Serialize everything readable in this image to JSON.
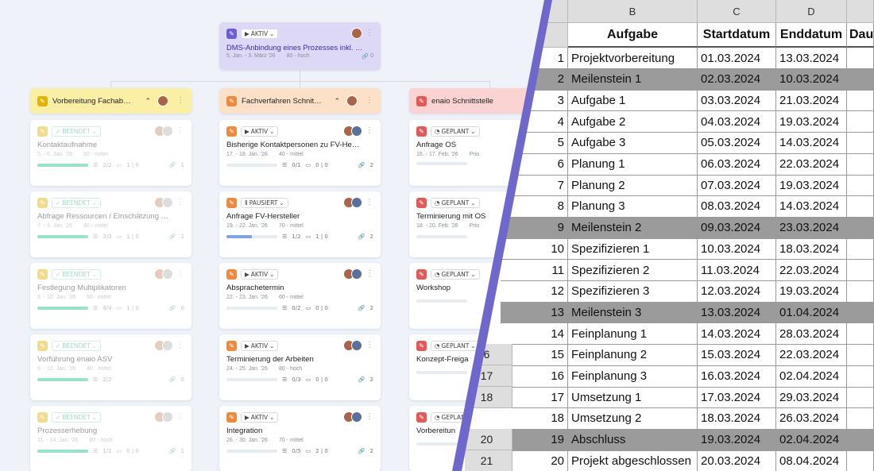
{
  "kanban": {
    "top_card": {
      "status": "AKTIV",
      "title": "DMS-Anbindung eines Prozesses inkl. …",
      "dates": "5. Jan. - 3. März '26",
      "effort": "80 - hoch",
      "links": "0"
    },
    "columns": [
      {
        "title": "Vorbereitung Fachab…",
        "collapse_icon": "chevron-up-icon",
        "cards": [
          {
            "status": "BEENDET",
            "title": "Kontaktaufnahme",
            "dates": "5. - 6. Jan. '26",
            "effort": "50 - mittel",
            "checklist": "2/2",
            "counts": "1 | 0",
            "links": "1",
            "progress": 100
          },
          {
            "status": "BEENDET",
            "title": "Abfrage Ressourcen / Einschätzung …",
            "dates": "7. - 9. Jan. '26",
            "effort": "60 - mittel",
            "checklist": "3/3",
            "counts": "1 | 0",
            "links": "1",
            "progress": 100
          },
          {
            "status": "BEENDET",
            "title": "Festlegung Multiplikatoren",
            "dates": "9. - 10. Jan. '26",
            "effort": "50 - mittel",
            "checklist": "4/4",
            "counts": "1 | 0",
            "links": "0",
            "progress": 100
          },
          {
            "status": "BEENDET",
            "title": "Vorführung enaio ASV",
            "dates": "9. - 12. Jan. '26",
            "effort": "40 - mittel",
            "checklist": "2/2",
            "counts": "",
            "links": "0",
            "progress": 100
          },
          {
            "status": "BEENDET",
            "title": "Prozesserhebung",
            "dates": "11. - 14. Jan. '26",
            "effort": "80 - hoch",
            "checklist": "1/1",
            "counts": "0 | 0",
            "links": "1",
            "progress": 100
          }
        ]
      },
      {
        "title": "Fachverfahren Schnit…",
        "collapse_icon": "chevron-up-icon",
        "cards": [
          {
            "status": "AKTIV",
            "title": "Bisherige Kontaktpersonen zu FV-He…",
            "dates": "17. - 18. Jan. '26",
            "effort": "40 - mittel",
            "checklist": "0/1",
            "counts": "0 | 0",
            "links": "2",
            "progress": 0
          },
          {
            "status": "PAUSIERT",
            "title": "Anfrage FV-Hersteller",
            "dates": "19. - 22. Jan. '26",
            "effort": "70 - mittel",
            "checklist": "1/2",
            "counts": "1 | 0",
            "links": "2",
            "progress": 50
          },
          {
            "status": "AKTIV",
            "title": "Absprachetermin",
            "dates": "22. - 23. Jan. '26",
            "effort": "60 - mittel",
            "checklist": "0/2",
            "counts": "0 | 0",
            "links": "2",
            "progress": 0
          },
          {
            "status": "AKTIV",
            "title": "Terminierung der Arbeiten",
            "dates": "24. - 25. Jan. '26",
            "effort": "80 - hoch",
            "checklist": "0/3",
            "counts": "0 | 0",
            "links": "2",
            "progress": 0
          },
          {
            "status": "AKTIV",
            "title": "Integration",
            "dates": "26. - 30. Jan. '26",
            "effort": "70 - mittel",
            "checklist": "0/5",
            "counts": "2 | 0",
            "links": "2",
            "progress": 0
          }
        ]
      },
      {
        "title": "enaio Schnittstelle",
        "cards": [
          {
            "status": "GEPLANT",
            "title": "Anfrage OS",
            "dates": "16. - 17. Feb. '26",
            "effort": "Prio",
            "checklist": "",
            "counts": "",
            "links": "",
            "progress": 0
          },
          {
            "status": "GEPLANT",
            "title": "Terminierung mit OS",
            "dates": "18. - 20. Feb. '26",
            "effort": "Prio",
            "checklist": "",
            "counts": "",
            "links": "0",
            "progress": 0
          },
          {
            "status": "GEPLANT",
            "title": "Workshop",
            "dates": "",
            "effort": "",
            "checklist": "",
            "counts": "",
            "links": "",
            "progress": 0
          },
          {
            "status": "GEPLANT",
            "title": "Konzept-Freiga",
            "dates": "",
            "effort": "",
            "checklist": "",
            "counts": "",
            "links": "",
            "progress": 0
          },
          {
            "status": "GEPLANT",
            "title": "Vorbereitun",
            "dates": "",
            "effort": "",
            "checklist": "",
            "counts": "",
            "links": "",
            "progress": 0
          }
        ]
      }
    ],
    "colors": {
      "top": "#dcd8f6",
      "col1": "#fbefa6",
      "col2": "#fde0c8",
      "col3": "#fbd3d3",
      "done": "#1fbf8a",
      "blue": "#7fa5e0",
      "pen_top": "#6b5dd3",
      "pen1": "#e0b400",
      "pen2": "#ef8a3c",
      "pen3": "#e05a5a"
    }
  },
  "sheet": {
    "col_letters": [
      "B",
      "C",
      "D"
    ],
    "headers": [
      "Aufgabe",
      "Startdatum",
      "Enddatum",
      "Dau"
    ],
    "left_row_numbers": [
      "6",
      "17",
      "18",
      "20",
      "21"
    ],
    "rows": [
      {
        "n": "1",
        "task": "Projektvorbereitung",
        "start": "01.03.2024",
        "end": "13.03.2024",
        "milestone": false
      },
      {
        "n": "2",
        "task": "Meilenstein 1",
        "start": "02.03.2024",
        "end": "10.03.2024",
        "milestone": true
      },
      {
        "n": "3",
        "task": "Aufgabe 1",
        "start": "03.03.2024",
        "end": "21.03.2024",
        "milestone": false
      },
      {
        "n": "4",
        "task": "Aufgabe 2",
        "start": "04.03.2024",
        "end": "19.03.2024",
        "milestone": false
      },
      {
        "n": "5",
        "task": "Aufgabe 3",
        "start": "05.03.2024",
        "end": "14.03.2024",
        "milestone": false
      },
      {
        "n": "6",
        "task": "Planung 1",
        "start": "06.03.2024",
        "end": "22.03.2024",
        "milestone": false
      },
      {
        "n": "7",
        "task": "Planung 2",
        "start": "07.03.2024",
        "end": "19.03.2024",
        "milestone": false
      },
      {
        "n": "8",
        "task": "Planung 3",
        "start": "08.03.2024",
        "end": "14.03.2024",
        "milestone": false
      },
      {
        "n": "9",
        "task": "Meilenstein 2",
        "start": "09.03.2024",
        "end": "23.03.2024",
        "milestone": true
      },
      {
        "n": "10",
        "task": "Spezifizieren 1",
        "start": "10.03.2024",
        "end": "18.03.2024",
        "milestone": false
      },
      {
        "n": "11",
        "task": "Spezifizieren 2",
        "start": "11.03.2024",
        "end": "22.03.2024",
        "milestone": false
      },
      {
        "n": "12",
        "task": "Spezifizieren 3",
        "start": "12.03.2024",
        "end": "19.03.2024",
        "milestone": false
      },
      {
        "n": "13",
        "task": "Meilenstein 3",
        "start": "13.03.2024",
        "end": "01.04.2024",
        "milestone": true
      },
      {
        "n": "14",
        "task": "Feinplanung 1",
        "start": "14.03.2024",
        "end": "28.03.2024",
        "milestone": false
      },
      {
        "n": "15",
        "task": "Feinplanung 2",
        "start": "15.03.2024",
        "end": "22.03.2024",
        "milestone": false
      },
      {
        "n": "16",
        "task": "Feinplanung 3",
        "start": "16.03.2024",
        "end": "02.04.2024",
        "milestone": false
      },
      {
        "n": "17",
        "task": "Umsetzung 1",
        "start": "17.03.2024",
        "end": "29.03.2024",
        "milestone": false
      },
      {
        "n": "18",
        "task": "Umsetzung 2",
        "start": "18.03.2024",
        "end": "26.03.2024",
        "milestone": false
      },
      {
        "n": "19",
        "task": "Abschluss",
        "start": "19.03.2024",
        "end": "02.04.2024",
        "milestone": true
      },
      {
        "n": "20",
        "task": "Projekt abgeschlossen",
        "start": "20.03.2024",
        "end": "08.04.2024",
        "milestone": false
      }
    ]
  }
}
